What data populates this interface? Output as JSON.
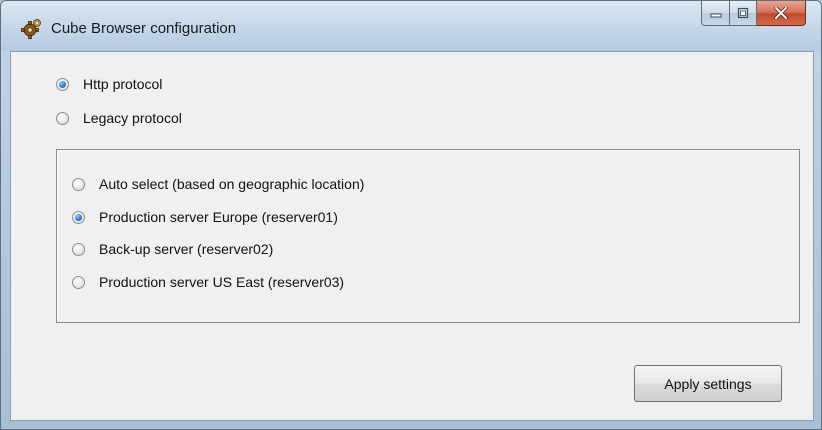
{
  "window": {
    "title": "Cube Browser configuration"
  },
  "protocol": {
    "options": [
      {
        "label": "Http protocol",
        "checked": true
      },
      {
        "label": "Legacy protocol",
        "checked": false
      }
    ]
  },
  "server": {
    "options": [
      {
        "label": "Auto select (based on geographic location)",
        "checked": false
      },
      {
        "label": "Production server Europe (reserver01)",
        "checked": true
      },
      {
        "label": "Back-up server (reserver02)",
        "checked": false
      },
      {
        "label": "Production server US East (reserver03)",
        "checked": false
      }
    ]
  },
  "actions": {
    "apply_label": "Apply settings"
  },
  "icons": {
    "app": "gear-icon",
    "minimize": "minimize-icon",
    "maximize": "maximize-icon",
    "close": "close-icon"
  },
  "colors": {
    "titlebar": "#c8d9ea",
    "client_background": "#f0f0f0",
    "close_button": "#c04a2c",
    "radio_selected": "#2a7fcf"
  }
}
